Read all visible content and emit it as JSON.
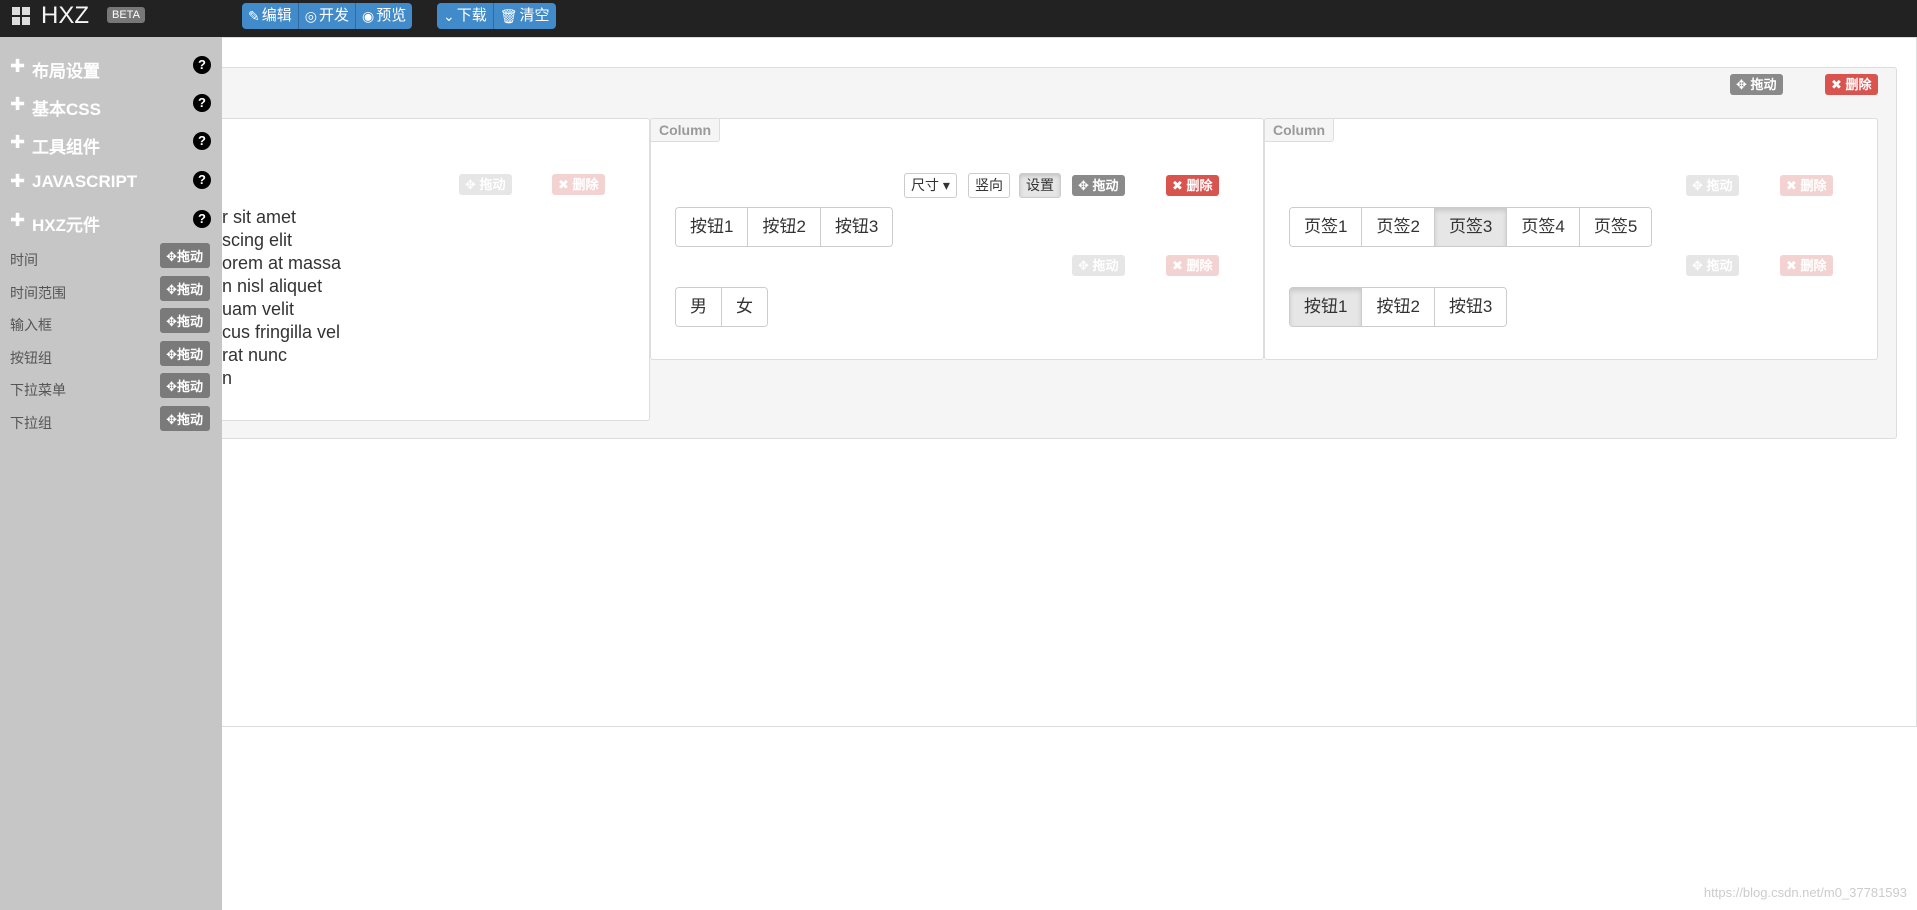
{
  "navbar": {
    "brand": "HXZ",
    "beta": "BETA",
    "buttons_left": [
      {
        "icon": "edit-icon",
        "label": "编辑"
      },
      {
        "icon": "eye-slash-icon",
        "label": "开发"
      },
      {
        "icon": "eye-icon",
        "label": "预览"
      }
    ],
    "buttons_right": [
      {
        "icon": "chevron-down-icon",
        "label": "下载"
      },
      {
        "icon": "trash-icon",
        "label": "清空"
      }
    ]
  },
  "sidebar": {
    "sections": [
      {
        "label": "布局设置"
      },
      {
        "label": "基本CSS"
      },
      {
        "label": "工具组件"
      },
      {
        "label": "JAVASCRIPT"
      },
      {
        "label": "HXZ元件"
      }
    ],
    "components": [
      {
        "label": "时间",
        "drag": "拖动"
      },
      {
        "label": "时间范围",
        "drag": "拖动"
      },
      {
        "label": "输入框",
        "drag": "拖动"
      },
      {
        "label": "按钮组",
        "drag": "拖动"
      },
      {
        "label": "下拉菜单",
        "drag": "拖动"
      },
      {
        "label": "下拉组",
        "drag": "拖动"
      }
    ]
  },
  "canvas": {
    "row_drag": "拖动",
    "row_delete": "删除",
    "col1": {
      "drag": "拖动",
      "delete": "删除",
      "lorem": [
        "r sit amet",
        "scing elit",
        "orem at massa",
        "n nisl aliquet",
        "uam velit",
        "cus fringilla vel",
        "rat nunc",
        "n"
      ]
    },
    "col2": {
      "tag": "Column",
      "size_label": "尺寸",
      "vertical_label": "竖向",
      "settings_label": "设置",
      "drag": "拖动",
      "delete": "删除",
      "group1": [
        "按钮1",
        "按钮2",
        "按钮3"
      ],
      "drag2": "拖动",
      "delete2": "删除",
      "group2": [
        "男",
        "女"
      ]
    },
    "col3": {
      "tag": "Column",
      "drag": "拖动",
      "delete": "删除",
      "tabs": [
        "页签1",
        "页签2",
        "页签3",
        "页签4",
        "页签5"
      ],
      "active_tab": "页签3",
      "drag2": "拖动",
      "delete2": "删除",
      "group": [
        "按钮1",
        "按钮2",
        "按钮3"
      ],
      "active_button": "按钮1"
    }
  },
  "watermark": "https://blog.csdn.net/m0_37781593",
  "colors": {
    "primary": "#428bca",
    "danger": "#d9534f",
    "sidebar": "#c6c6c6",
    "navbar": "#222222"
  }
}
